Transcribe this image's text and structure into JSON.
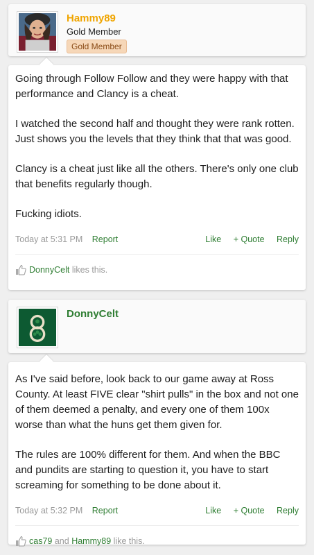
{
  "colors": {
    "gold_username": "#f0a500",
    "green_link": "#2e7d32",
    "meta_gray": "#999999"
  },
  "posts": [
    {
      "author": {
        "username": "Hammy89",
        "user_title": "Gold Member",
        "banner": "Gold Member",
        "avatar": "user-photo-avatar"
      },
      "message": [
        "Going through Follow Follow and they were happy with that performance and Clancy is a cheat.",
        "I watched the second half and thought they were rank rotten. Just shows you the levels that they think that that was good.",
        "Clancy is a cheat just like all the others. There's only one club that benefits regularly though.",
        "Fucking idiots."
      ],
      "timestamp": "Today at 5:31 PM",
      "report_label": "Report",
      "like_label": "Like",
      "quote_label": "+ Quote",
      "reply_label": "Reply",
      "likes": {
        "users": [
          "DonnyCelt"
        ],
        "suffix": "likes this."
      }
    },
    {
      "author": {
        "username": "DonnyCelt",
        "avatar": "celtic-crest-avatar"
      },
      "message": [
        "As I've said before, look back to our game away at Ross County. At least FIVE clear \"shirt pulls\" in the box and not one of them deemed a penalty, and every one of them 100x worse than what the huns get them given for.",
        "The rules are 100% different for them. And when the BBC and pundits are starting to question it, you have to start screaming for something to be done about it."
      ],
      "timestamp": "Today at 5:32 PM",
      "report_label": "Report",
      "like_label": "Like",
      "quote_label": "+ Quote",
      "reply_label": "Reply",
      "likes": {
        "users": [
          "cas79",
          "Hammy89"
        ],
        "joiner": "and",
        "suffix": "like this."
      }
    }
  ]
}
